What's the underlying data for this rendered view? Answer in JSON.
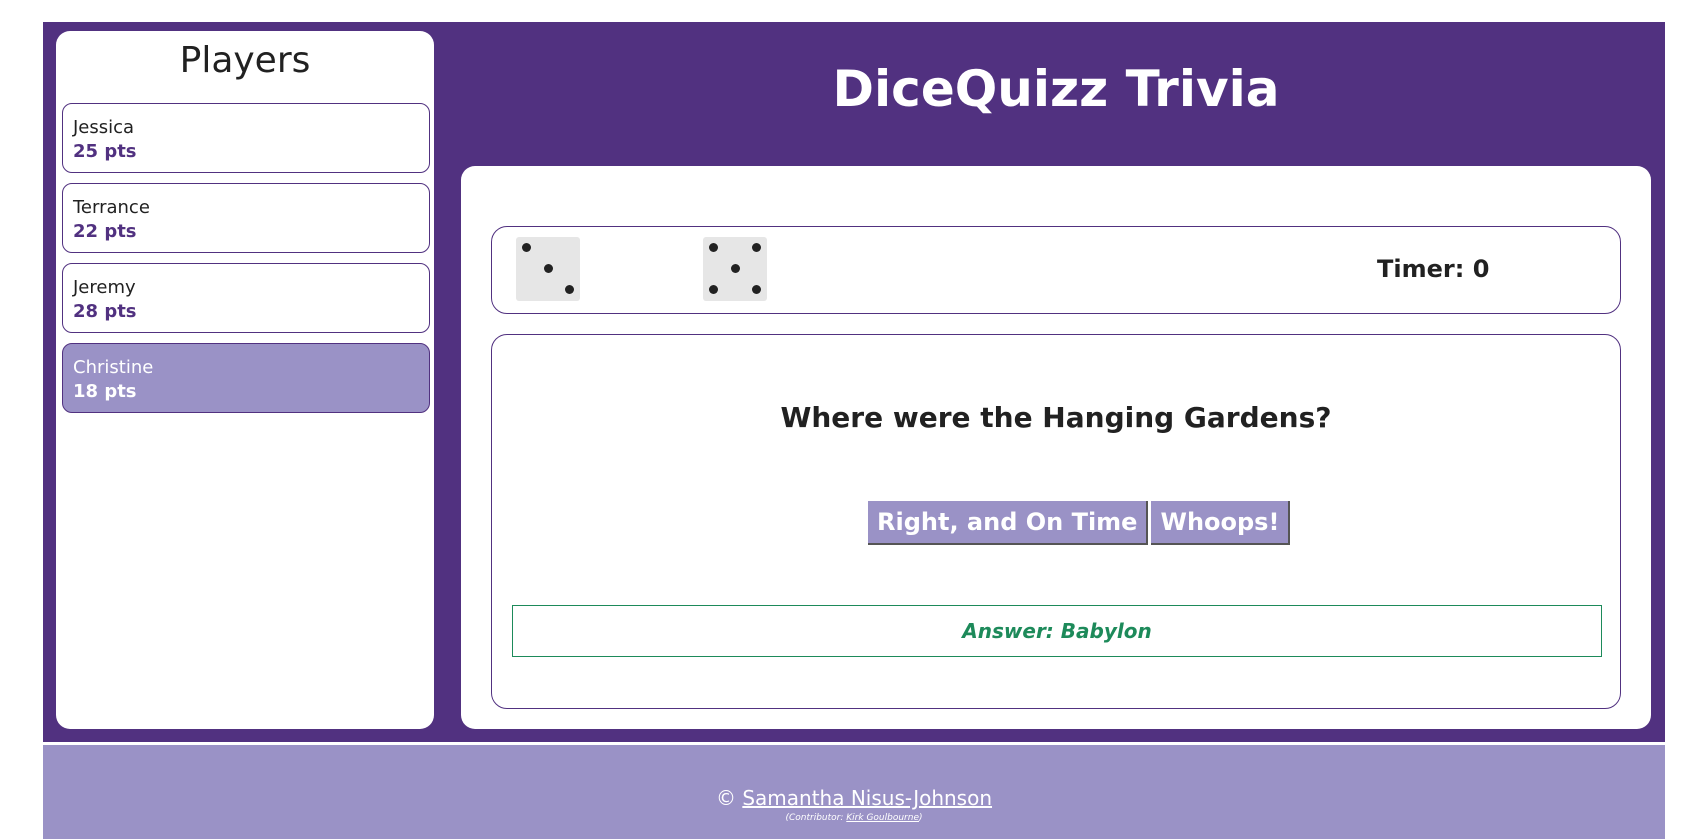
{
  "players_panel": {
    "title": "Players",
    "players": [
      {
        "name": "Jessica",
        "points": "25 pts",
        "active": false
      },
      {
        "name": "Terrance",
        "points": "22 pts",
        "active": false
      },
      {
        "name": "Jeremy",
        "points": "28 pts",
        "active": false
      },
      {
        "name": "Christine",
        "points": "18 pts",
        "active": true
      }
    ]
  },
  "header": {
    "title": "DiceQuizz Trivia"
  },
  "dice": {
    "values": [
      3,
      5
    ],
    "timer_label": "Timer:",
    "timer_value": "0"
  },
  "question": {
    "text": "Where were the Hanging Gardens?",
    "buttons": {
      "right": "Right, and On Time",
      "wrong": "Whoops!"
    },
    "answer_label": "Answer:",
    "answer_value": "Babylon"
  },
  "footer": {
    "copyright_symbol": "©",
    "author": "Samantha Nisus-Johnson",
    "contributor_prefix": "(Contributor: ",
    "contributor_name": "Kirk Goulbourne",
    "contributor_suffix": ")"
  },
  "colors": {
    "brand_purple": "#513180",
    "light_purple": "#9a92c6",
    "answer_green": "#1d8a5a"
  }
}
